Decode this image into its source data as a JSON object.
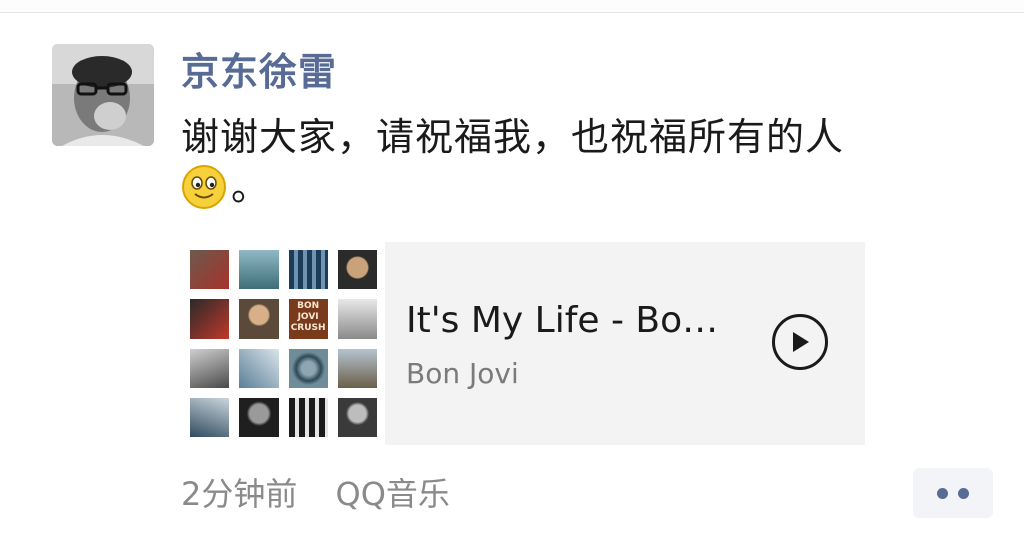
{
  "post": {
    "author": "京东徐雷",
    "text_line1": "谢谢大家，请祝福我，也祝福所有的人",
    "text_line2_suffix": "。",
    "emoji": "smile-emoji",
    "timestamp": "2分钟前",
    "source": "QQ音乐"
  },
  "music_card": {
    "title": "It's My Life - Bo…",
    "artist": "Bon Jovi",
    "cover_text": [
      "BON",
      "JOVI",
      "CRUSH"
    ]
  },
  "colors": {
    "name": "#576b95",
    "card_bg": "#f3f3f3",
    "meta": "#8a8a8a"
  }
}
